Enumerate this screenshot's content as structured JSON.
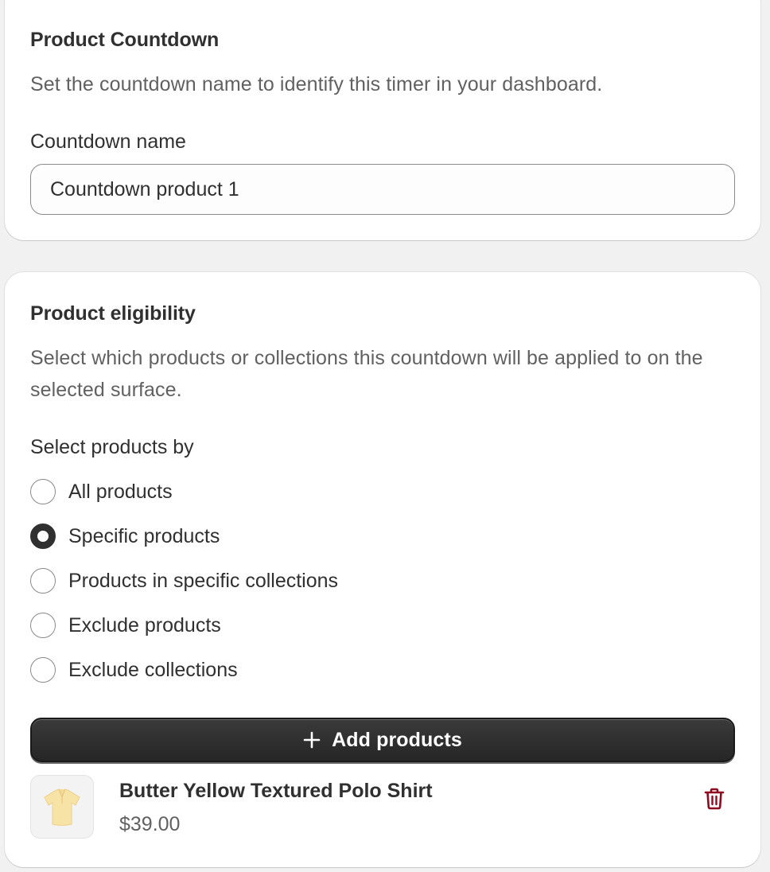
{
  "countdown_card": {
    "title": "Product Countdown",
    "description": "Set the countdown name to identify this timer in your dashboard.",
    "name_label": "Countdown name",
    "name_value": "Countdown product 1"
  },
  "eligibility_card": {
    "title": "Product eligibility",
    "description": "Select which products or collections this countdown will be applied to on the selected surface.",
    "select_label": "Select products by",
    "options": [
      {
        "label": "All products",
        "checked": false
      },
      {
        "label": "Specific products",
        "checked": true
      },
      {
        "label": "Products in specific collections",
        "checked": false
      },
      {
        "label": "Exclude products",
        "checked": false
      },
      {
        "label": "Exclude collections",
        "checked": false
      }
    ],
    "add_button_label": "Add products",
    "add_button_icon": "plus-icon",
    "products": [
      {
        "title": "Butter Yellow Textured Polo Shirt",
        "price": "$39.00",
        "thumbnail_icon": "polo-shirt-image",
        "delete_icon": "trash-icon"
      }
    ]
  },
  "colors": {
    "page_background": "#f1f1f1",
    "card_background": "#ffffff",
    "primary_button": "#303030",
    "delete_icon": "#8e0b21",
    "shirt": "#f8e3a6"
  }
}
